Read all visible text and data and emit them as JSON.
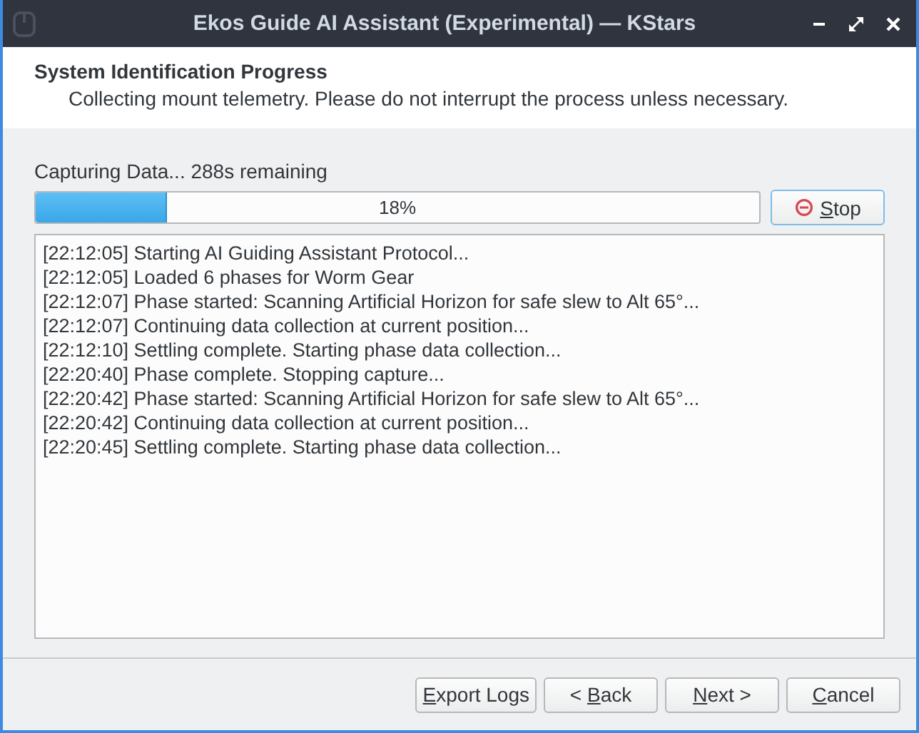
{
  "window": {
    "title": "Ekos Guide AI Assistant (Experimental) — KStars"
  },
  "header": {
    "title": "System Identification Progress",
    "subtitle": "Collecting mount telemetry. Please do not interrupt the process unless necessary."
  },
  "status": "Capturing Data... 288s remaining",
  "progress": {
    "level": 0.18,
    "label": "18%"
  },
  "stop_button": {
    "mnemonic": "S",
    "after": "top"
  },
  "log": [
    "[22:12:05] Starting AI Guiding Assistant Protocol...",
    "[22:12:05] Loaded 6 phases for Worm Gear",
    "[22:12:07] Phase started: Scanning Artificial Horizon for safe slew to Alt 65°...",
    "[22:12:07] Continuing data collection at current position...",
    "[22:12:10] Settling complete. Starting phase data collection...",
    "[22:20:40] Phase complete. Stopping capture...",
    "[22:20:42] Phase started: Scanning Artificial Horizon for safe slew to Alt 65°...",
    "[22:20:42] Continuing data collection at current position...",
    "[22:20:45] Settling complete. Starting phase data collection..."
  ],
  "buttons": [
    {
      "mnemonic": "E",
      "after": "xport Logs"
    },
    {
      "before": "< ",
      "mnemonic": "B",
      "after": "ack"
    },
    {
      "mnemonic": "N",
      "after": "ext >"
    },
    {
      "mnemonic": "C",
      "after": "ancel"
    }
  ]
}
